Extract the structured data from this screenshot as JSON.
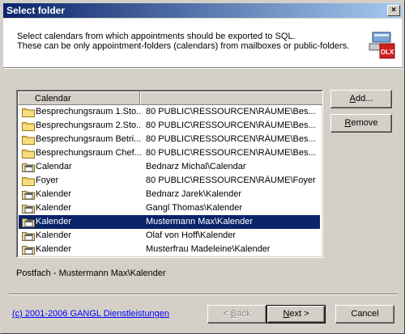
{
  "window": {
    "title": "Select folder",
    "close_glyph": "×"
  },
  "header": {
    "description_line1": "Select calendars from which appointments should be exported to SQL.",
    "description_line2": "These can be only appointment-folders (calendars) from mailboxes or public-folders.",
    "logo_text": "OLX",
    "logo_icon": "olx-logo-icon"
  },
  "list": {
    "columns": [
      "Calendar",
      ""
    ],
    "rows": [
      {
        "icon": "folder-icon",
        "name": "Besprechungsraum 1.Sto...",
        "path": "80 PUBLIC\\RESSOURCEN\\RÄUME\\Bes...",
        "selected": false
      },
      {
        "icon": "folder-icon",
        "name": "Besprechungsraum 2.Sto...",
        "path": "80 PUBLIC\\RESSOURCEN\\RÄUME\\Bes...",
        "selected": false
      },
      {
        "icon": "folder-icon",
        "name": "Besprechungsraum Betri...",
        "path": "80 PUBLIC\\RESSOURCEN\\RÄUME\\Bes...",
        "selected": false
      },
      {
        "icon": "folder-icon",
        "name": "Besprechungsraum Chef...",
        "path": "80 PUBLIC\\RESSOURCEN\\RÄUME\\Bes...",
        "selected": false
      },
      {
        "icon": "calendar-folder-icon",
        "name": "Calendar",
        "path": "Bednarz Michal\\Calendar",
        "selected": false
      },
      {
        "icon": "folder-icon",
        "name": "Foyer",
        "path": "80 PUBLIC\\RESSOURCEN\\RÄUME\\Foyer",
        "selected": false
      },
      {
        "icon": "calendar-folder-icon",
        "name": "Kalender",
        "path": "Bednarz Jarek\\Kalender",
        "selected": false
      },
      {
        "icon": "calendar-folder-icon",
        "name": "Kalender",
        "path": "Gangl Thomas\\Kalender",
        "selected": false
      },
      {
        "icon": "calendar-folder-icon",
        "name": "Kalender",
        "path": "Mustermann Max\\Kalender",
        "selected": true
      },
      {
        "icon": "calendar-folder-icon",
        "name": "Kalender",
        "path": "Olaf von Hoff\\Kalender",
        "selected": false
      },
      {
        "icon": "calendar-folder-icon",
        "name": "Kalender",
        "path": "Musterfrau Madeleine\\Kalender",
        "selected": false
      }
    ]
  },
  "side_buttons": {
    "add_mnemonic": "A",
    "add_rest": "dd...",
    "remove_mnemonic": "R",
    "remove_rest": "emove"
  },
  "status": {
    "text": "Postfach - Mustermann Max\\Kalender"
  },
  "footer": {
    "copyright": "(c) 2001-2006 GANGL Dienstleistungen",
    "back_prefix": "< ",
    "back_mnemonic": "B",
    "back_rest": "ack",
    "next_mnemonic": "N",
    "next_rest": "ext >",
    "cancel_label": "Cancel"
  },
  "colors": {
    "selection": "#0a246a",
    "title_gradient_start": "#0a246a",
    "title_gradient_end": "#a6caf0",
    "dialog_face": "#d4d0c8",
    "link": "#0000ff",
    "folder_yellow": "#f0c850"
  }
}
